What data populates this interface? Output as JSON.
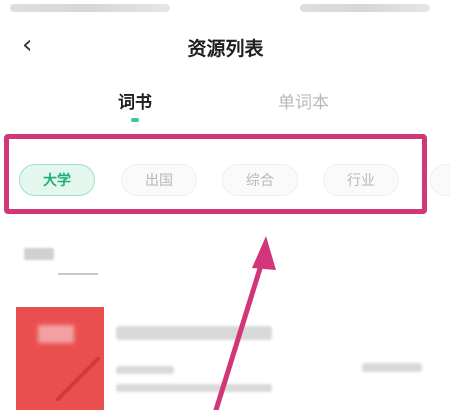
{
  "header": {
    "title": "资源列表",
    "back_icon": "chevron-left-icon"
  },
  "tabs": [
    {
      "label": "词书",
      "active": true
    },
    {
      "label": "单词本",
      "active": false
    }
  ],
  "categories": [
    {
      "label": "大学",
      "selected": true
    },
    {
      "label": "出国",
      "selected": false
    },
    {
      "label": "综合",
      "selected": false
    },
    {
      "label": "行业",
      "selected": false
    },
    {
      "label": "",
      "selected": false
    }
  ],
  "colors": {
    "accent": "#3fc99a",
    "highlight": "#d1357a",
    "book_cover": "#ea4f4f"
  }
}
